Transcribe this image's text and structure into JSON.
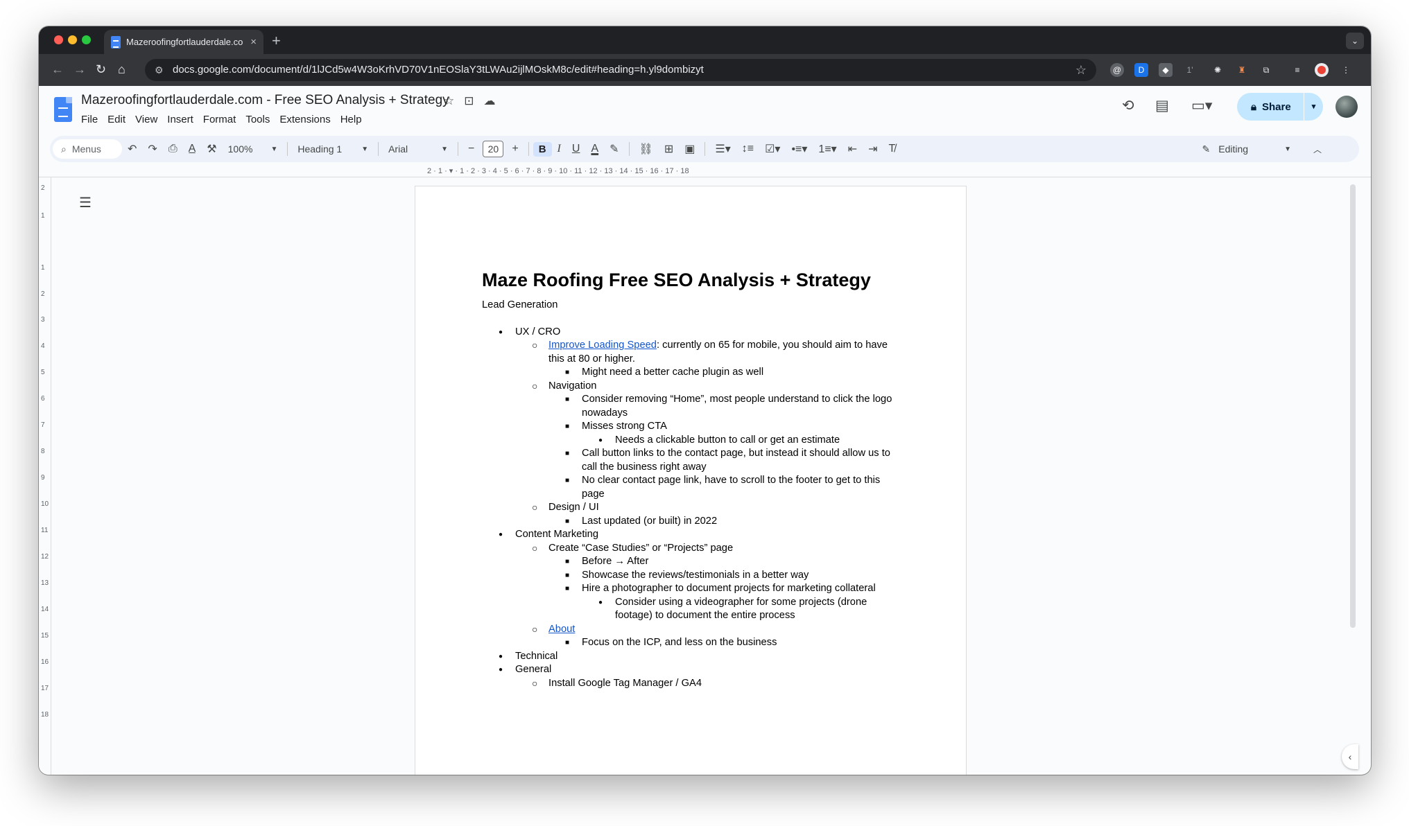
{
  "browser": {
    "tab_title": "Mazeroofingfortlauderdale.co",
    "tab_close": "×",
    "new_tab": "+",
    "url": "docs.google.com/document/d/1lJCd5w4W3oKrhVD70V1nEOSlaY3tLWAu2ijlMOskM8c/edit#heading=h.yl9dombizyt",
    "tab_menu": "⌄"
  },
  "docs": {
    "title": "Mazeroofingfortlauderdale.com - Free SEO Analysis + Strategy",
    "menu": [
      "File",
      "Edit",
      "View",
      "Insert",
      "Format",
      "Tools",
      "Extensions",
      "Help"
    ],
    "share_label": "Share",
    "toolbar": {
      "menus_label": "Menus",
      "zoom": "100%",
      "style": "Heading 1",
      "font": "Arial",
      "font_size": "20",
      "mode": "Editing"
    }
  },
  "document": {
    "heading": "Maze Roofing Free SEO Analysis + Strategy",
    "subheading": "Lead Generation",
    "items": [
      {
        "level": 1,
        "text": "UX / CRO"
      },
      {
        "level": 2,
        "link": "Improve Loading Speed",
        "text": ": currently on 65 for mobile, you should aim to have this at 80 or higher."
      },
      {
        "level": 3,
        "text": "Might need a better cache plugin as well"
      },
      {
        "level": 2,
        "text": "Navigation"
      },
      {
        "level": 3,
        "text": "Consider removing “Home”, most people understand to click the logo nowadays"
      },
      {
        "level": 3,
        "text": "Misses strong CTA"
      },
      {
        "level": 4,
        "text": "Needs a clickable button to call or get an estimate"
      },
      {
        "level": 3,
        "text": "Call button links to the contact page, but instead it should allow us to call the business right away"
      },
      {
        "level": 3,
        "text": "No clear contact page link, have to scroll to the footer to get to this page"
      },
      {
        "level": 2,
        "text": "Design / UI"
      },
      {
        "level": 3,
        "text": "Last updated (or built) in 2022"
      },
      {
        "level": 1,
        "text": "Content Marketing"
      },
      {
        "level": 2,
        "text": "Create “Case Studies” or “Projects” page"
      },
      {
        "level": 3,
        "text": "Before → After"
      },
      {
        "level": 3,
        "text": "Showcase the reviews/testimonials in a better way"
      },
      {
        "level": 3,
        "text": "Hire a photographer to document projects for marketing collateral"
      },
      {
        "level": 4,
        "text": "Consider using a videographer for some projects (drone footage) to document the entire process"
      },
      {
        "level": 2,
        "link": "About",
        "text": ""
      },
      {
        "level": 3,
        "text": "Focus on the ICP, and less on the business"
      },
      {
        "level": 1,
        "text": "Technical"
      },
      {
        "level": 1,
        "text": "General"
      },
      {
        "level": 2,
        "text": "Install Google Tag Manager / GA4"
      }
    ]
  },
  "ruler": {
    "horizontal": "2 · 1 · ▾ · 1 · 2 · 3 · 4 · 5 · 6 · 7 · 8 · 9 · 10 · 11 · 12 · 13 · 14 · 15 · 16 · 17 · 18",
    "vertical": [
      "2",
      "1",
      "1",
      "2",
      "3",
      "4",
      "5",
      "6",
      "7",
      "8",
      "9",
      "10",
      "11",
      "12",
      "13",
      "14",
      "15",
      "16",
      "17",
      "18"
    ]
  },
  "colors": {
    "accent": "#c2e7ff",
    "link": "#1155cc",
    "chrome_dark": "#202124"
  }
}
